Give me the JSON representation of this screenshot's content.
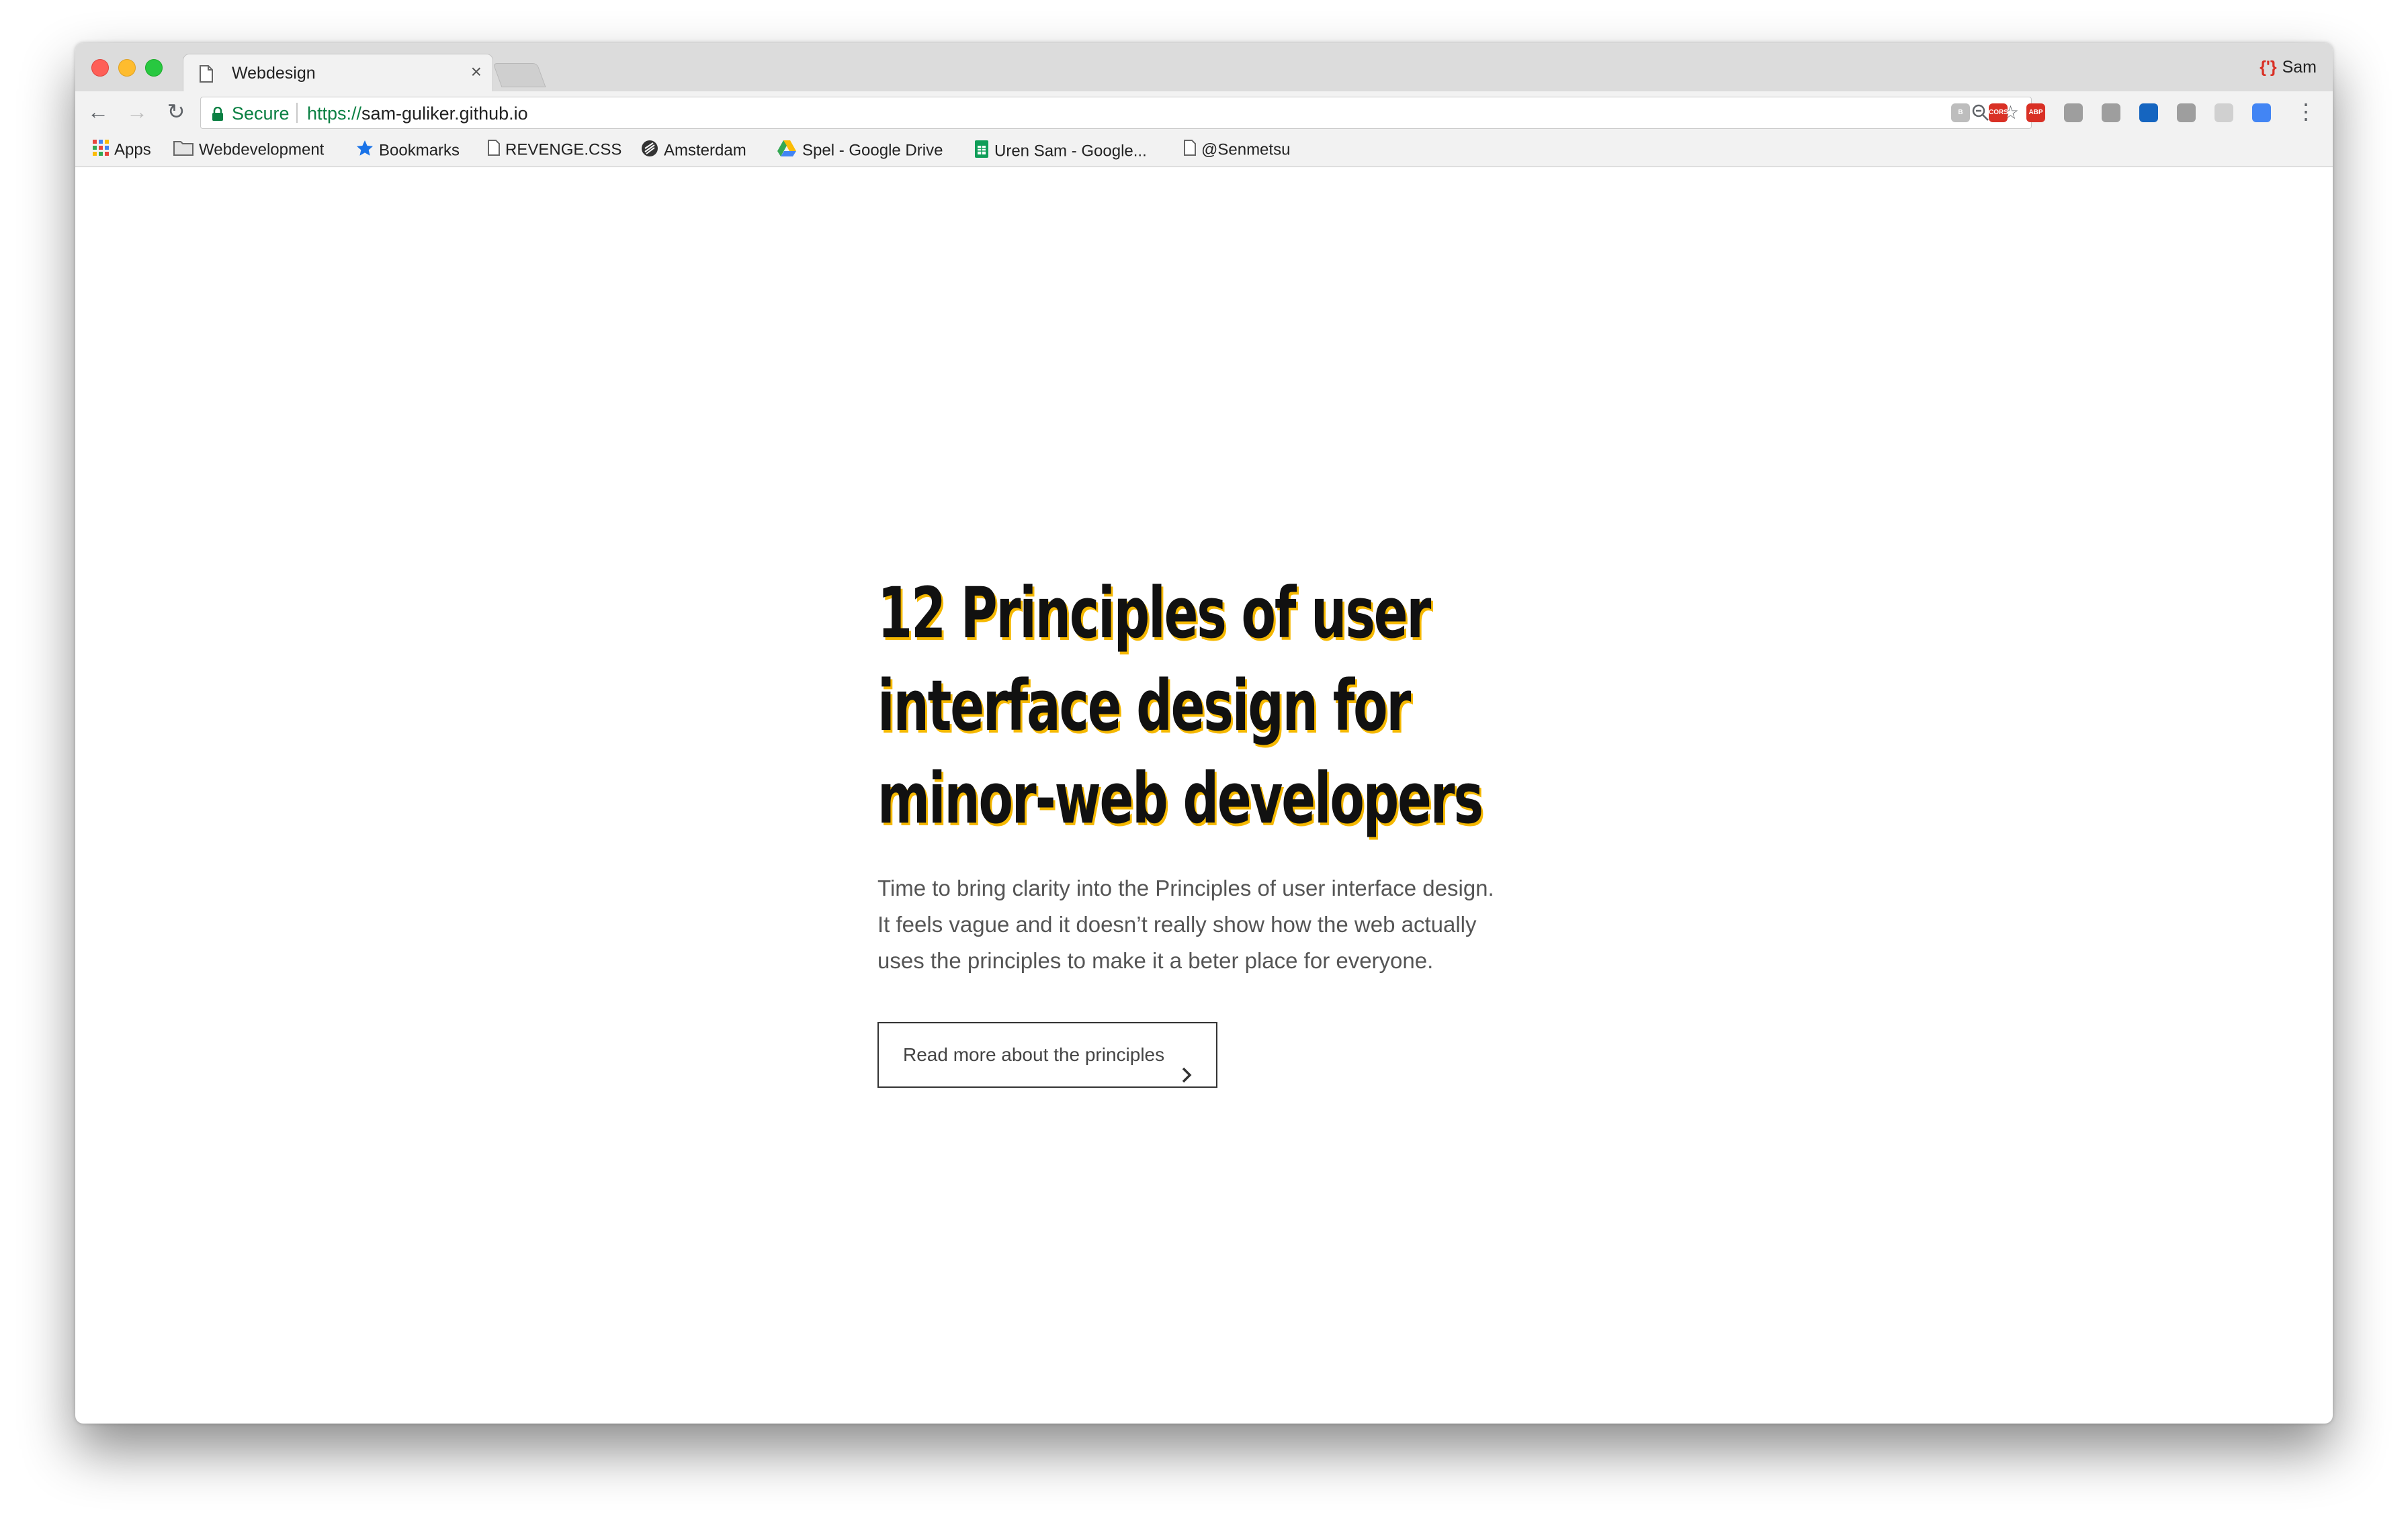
{
  "browser": {
    "tab": {
      "title": "Webdesign",
      "close": "×"
    },
    "profile": {
      "name": "Sam"
    },
    "nav": {
      "back": "←",
      "forward": "→",
      "reload": "↻"
    },
    "omnibox": {
      "secure_label": "Secure",
      "url_scheme": "https://",
      "url_host": "sam-guliker.github.io"
    },
    "extensions": [
      {
        "name": "B",
        "color": "#bdbdbd"
      },
      {
        "name": "CORS",
        "color": "#d93025"
      },
      {
        "name": "ABP",
        "color": "#d93025"
      },
      {
        "name": "",
        "color": "#9e9e9e"
      },
      {
        "name": "",
        "color": "#9e9e9e"
      },
      {
        "name": "",
        "color": "#1565c0"
      },
      {
        "name": "",
        "color": "#9e9e9e"
      },
      {
        "name": "",
        "color": "#d0d0d0"
      },
      {
        "name": "",
        "color": "#4285f4"
      }
    ],
    "bookmarks": [
      {
        "label": "Apps",
        "icon": "apps-grid-icon"
      },
      {
        "label": "Webdevelopment",
        "icon": "folder-icon"
      },
      {
        "label": "Bookmarks",
        "icon": "star-icon"
      },
      {
        "label": "REVENGE.CSS",
        "icon": "document-icon"
      },
      {
        "label": "Amsterdam",
        "icon": "globe-icon"
      },
      {
        "label": "Spel - Google Drive",
        "icon": "google-drive-icon"
      },
      {
        "label": "Uren Sam - Google...",
        "icon": "sheets-icon"
      },
      {
        "label": "@Senmetsu",
        "icon": "document-icon"
      }
    ]
  },
  "page": {
    "title_lines": [
      "12 Principles of user",
      "interface design for",
      "minor-web developers"
    ],
    "intro_lines": [
      "Time to bring clarity into the Principles of user interface design.",
      "It feels vague and it doesn’t really show how the web actually",
      "uses the principles to make it a beter place for everyone."
    ],
    "cta_label": "Read more about the principles",
    "accent_color": "#f5b800"
  }
}
